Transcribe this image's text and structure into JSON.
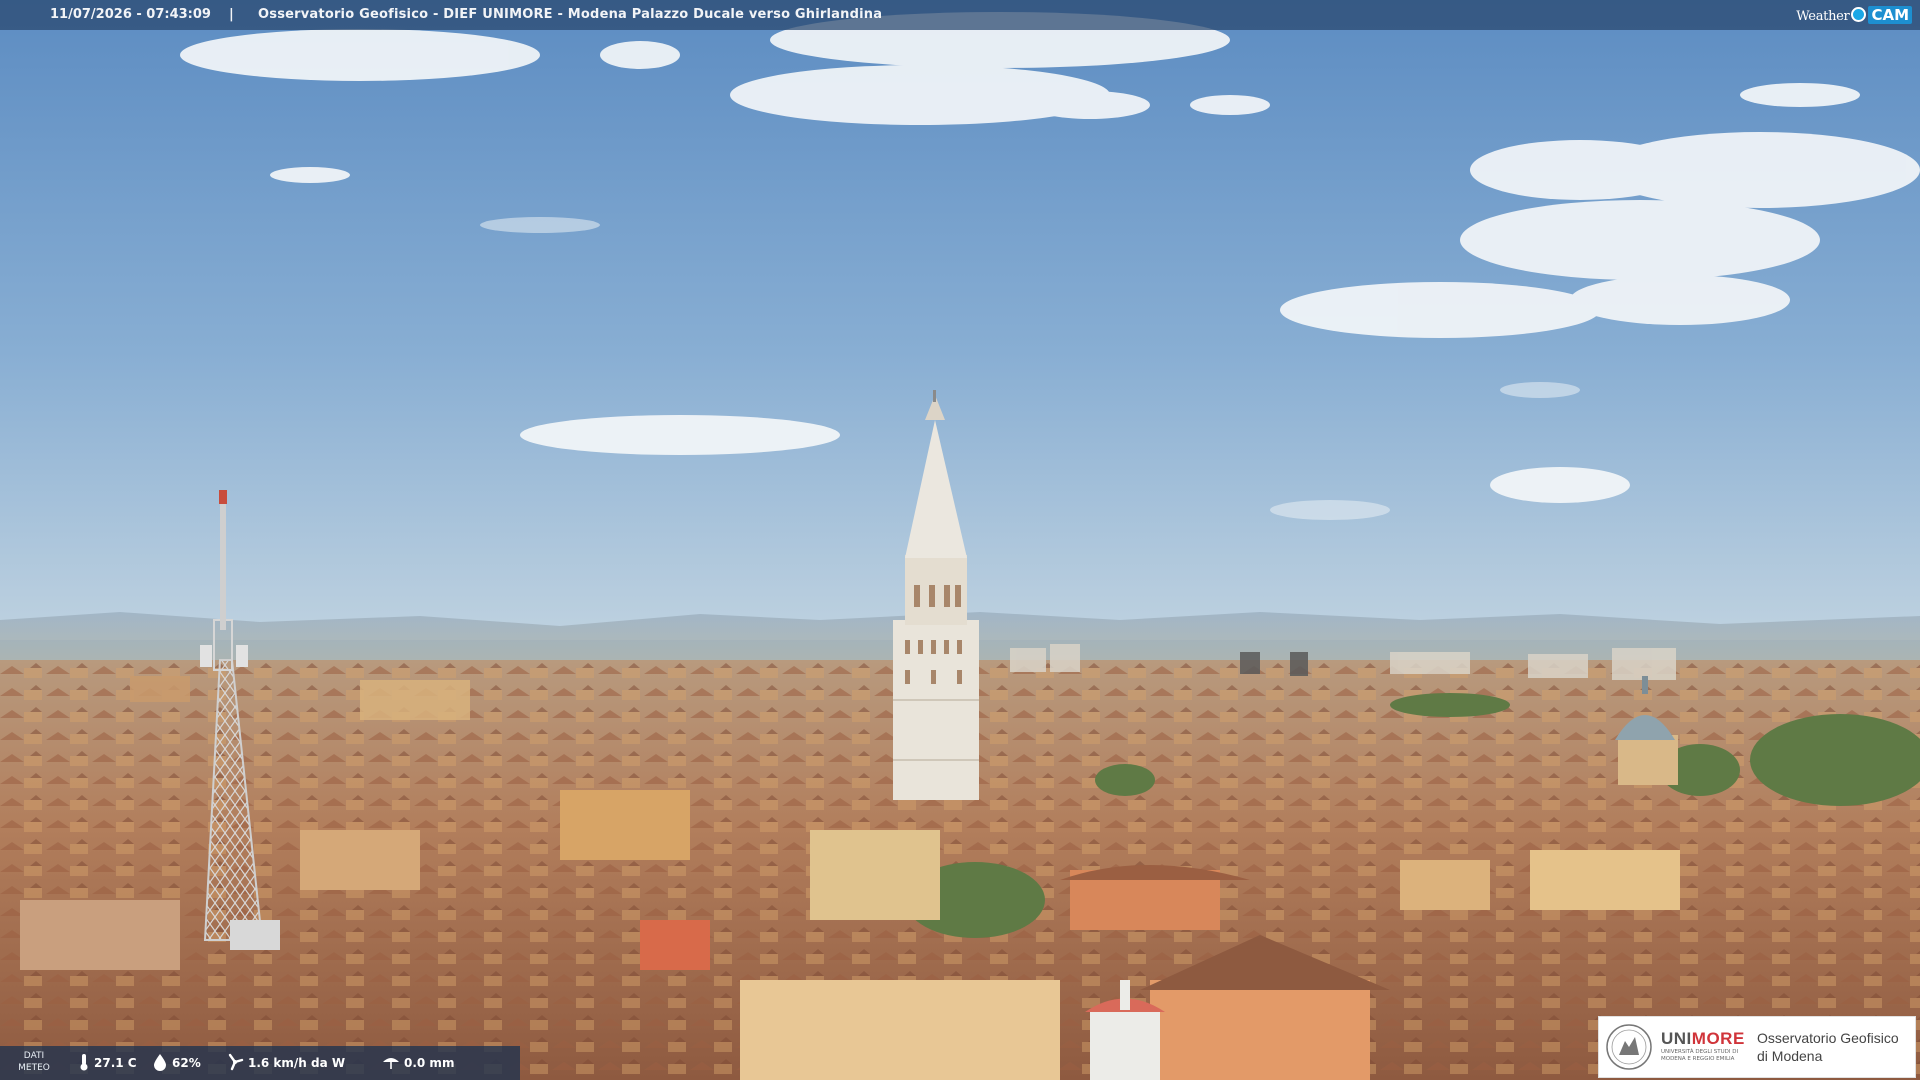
{
  "header": {
    "datetime": "11/07/2026 - 07:43:09",
    "separator": "|",
    "caption": "Osservatorio Geofisico - DIEF UNIMORE - Modena Palazzo Ducale verso Ghirlandina",
    "brand_weather": "Weather",
    "brand_cam": "CAM"
  },
  "weather_data": {
    "label_line1": "DATI",
    "label_line2": "METEO",
    "temperature": "27.1 C",
    "humidity": "62%",
    "wind": "1.6 km/h da W",
    "rain": "0.0 mm"
  },
  "institution": {
    "name_part1": "UNI",
    "name_part2": "MORE",
    "subtitle": "UNIVERSITÀ DEGLI STUDI DI MODENA E REGGIO EMILIA",
    "observatory_line1": "Osservatorio Geofisico",
    "observatory_line2": "di Modena"
  },
  "colors": {
    "sky_top": "#5f8fc4",
    "sky_horizon": "#b9cfe0",
    "roof": "#a86a4a",
    "wall": "#d9a66c",
    "tower": "#e8e2d6",
    "accent_red": "#d0343a"
  },
  "icons": [
    "thermometer-icon",
    "humidity-drop-icon",
    "wind-icon",
    "rain-icon"
  ]
}
